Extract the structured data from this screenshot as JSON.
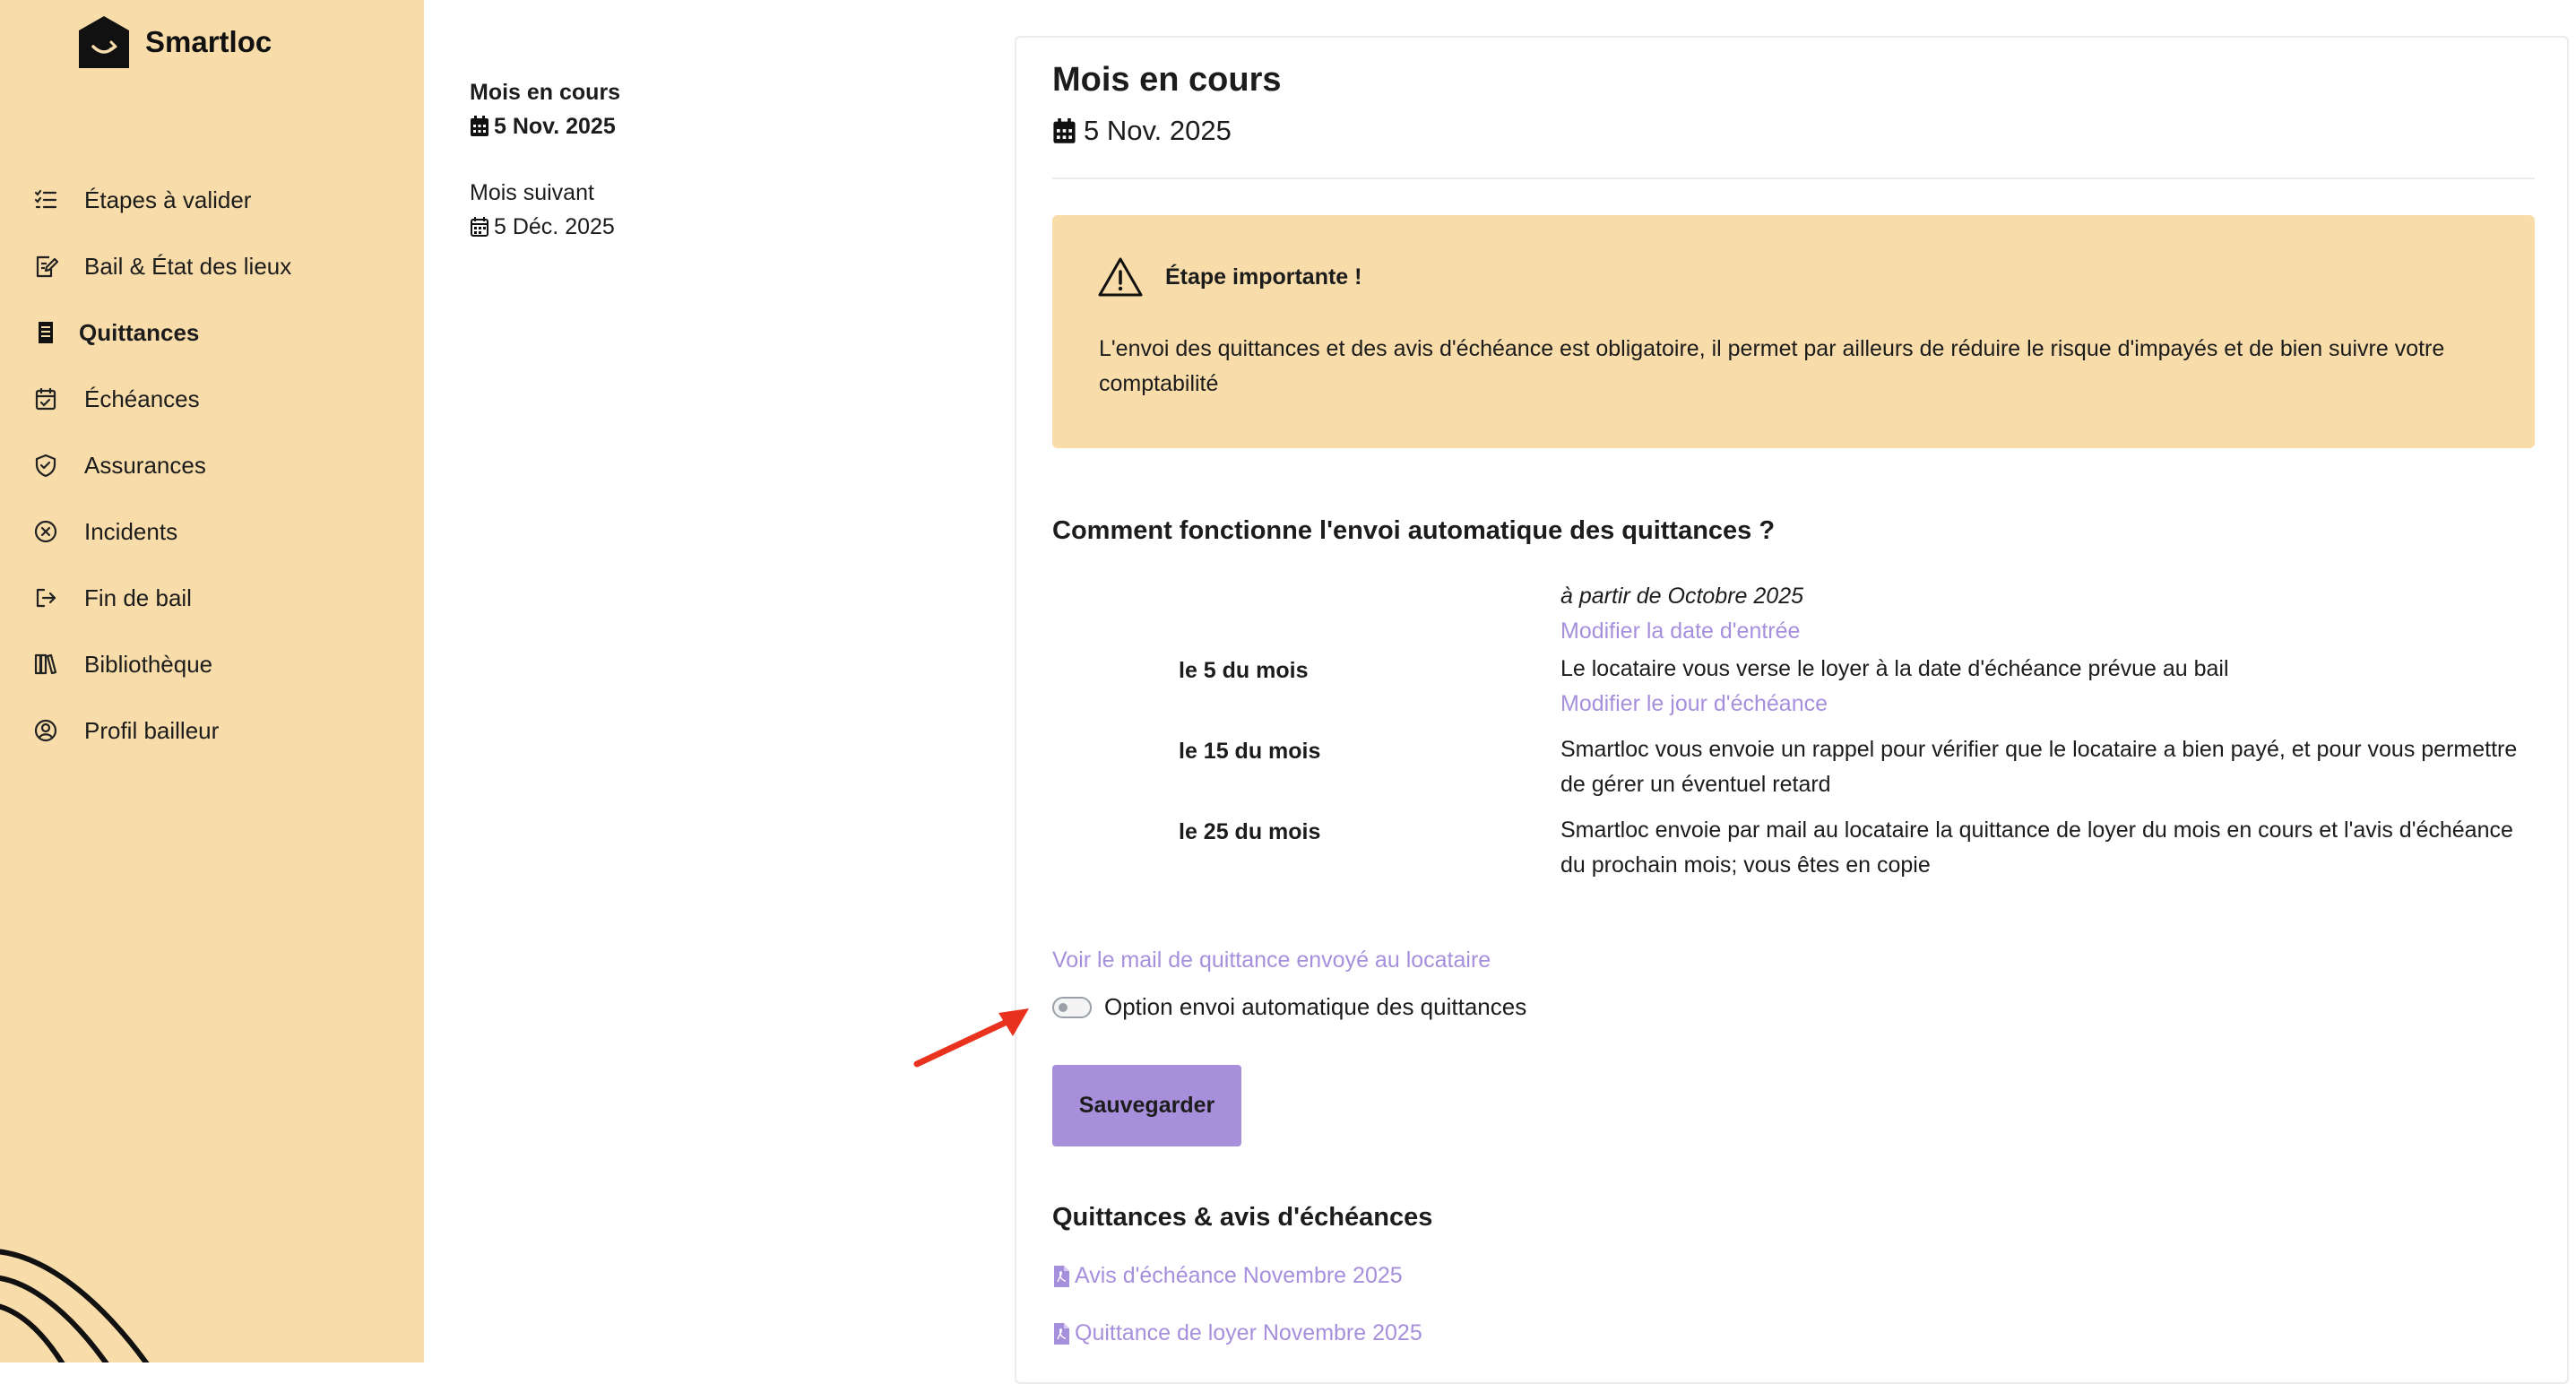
{
  "brand": {
    "name": "Smartloc"
  },
  "sidebar": {
    "items": [
      {
        "label": "Étapes à valider",
        "icon": "checklist-icon",
        "active": false
      },
      {
        "label": "Bail & État des lieux",
        "icon": "document-edit-icon",
        "active": false
      },
      {
        "label": "Quittances",
        "icon": "receipt-icon",
        "active": true
      },
      {
        "label": "Échéances",
        "icon": "calendar-check-icon",
        "active": false
      },
      {
        "label": "Assurances",
        "icon": "shield-check-icon",
        "active": false
      },
      {
        "label": "Incidents",
        "icon": "circle-x-icon",
        "active": false
      },
      {
        "label": "Fin de bail",
        "icon": "exit-icon",
        "active": false
      },
      {
        "label": "Bibliothèque",
        "icon": "library-icon",
        "active": false
      },
      {
        "label": "Profil bailleur",
        "icon": "user-circle-icon",
        "active": false
      }
    ]
  },
  "months": [
    {
      "label": "Mois en cours",
      "date": "5 Nov. 2025",
      "active": true
    },
    {
      "label": "Mois suivant",
      "date": "5 Déc. 2025",
      "active": false
    }
  ],
  "main": {
    "title": "Mois en cours",
    "date": "5 Nov. 2025",
    "alert": {
      "title": "Étape importante !",
      "text": "L'envoi des quittances et des avis d'échéance est obligatoire, il permet par ailleurs de réduire le risque d'impayés et de bien suivre votre comptabilité"
    },
    "how_title": "Comment fonctionne l'envoi automatique des quittances ?",
    "schedule": {
      "start_text": "à partir de Octobre 2025",
      "start_link": "Modifier la date d'entrée",
      "rows": [
        {
          "day": "le 5 du mois",
          "text": "Le locataire vous verse le loyer à la date d'échéance prévue au bail",
          "link": "Modifier le jour d'échéance"
        },
        {
          "day": "le 15 du mois",
          "text": "Smartloc vous envoie un rappel pour vérifier que le locataire a bien payé, et pour vous permettre de gérer un éventuel retard"
        },
        {
          "day": "le 25 du mois",
          "text": "Smartloc envoie par mail au locataire la quittance de loyer du mois en cours et l'avis d'échéance du prochain mois; vous êtes en copie"
        }
      ]
    },
    "preview_link": "Voir le mail de quittance envoyé au locataire",
    "toggle": {
      "label": "Option envoi automatique des quittances",
      "checked": false
    },
    "save_label": "Sauvegarder",
    "docs_title": "Quittances & avis d'échéances",
    "docs": [
      "Avis d'échéance Novembre 2025",
      "Quittance de loyer Novembre 2025"
    ]
  },
  "colors": {
    "sidebar_bg": "#f8dca9",
    "accent": "#a78fdc",
    "link": "#a68fdc",
    "arrow": "#e8321e"
  }
}
